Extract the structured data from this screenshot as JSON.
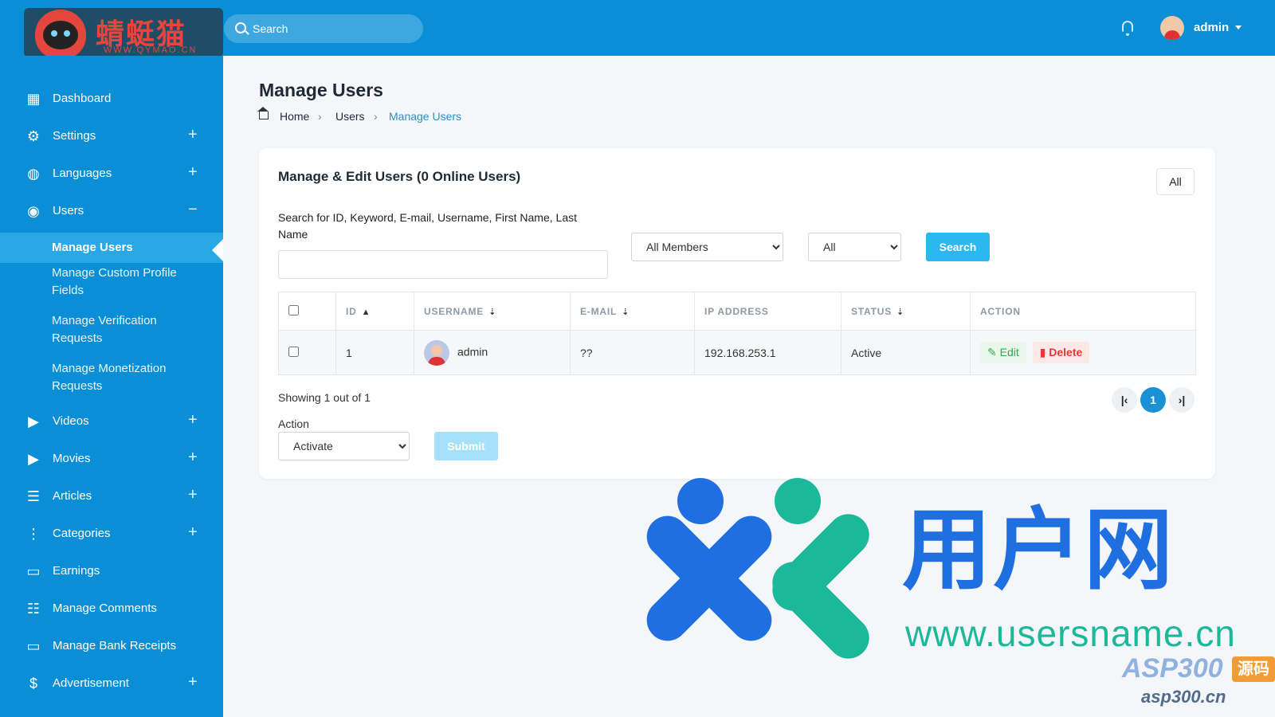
{
  "brand": {
    "logo_text": "蜻蜓猫",
    "logo_sub": "WWW.QYMAO.CN"
  },
  "topbar": {
    "search_placeholder": "Search",
    "user_name": "admin"
  },
  "sidebar": {
    "items": [
      {
        "label": "Dashboard",
        "icon": "dashboard-icon",
        "glyph": "▦",
        "expand": ""
      },
      {
        "label": "Settings",
        "icon": "gear-icon",
        "glyph": "⚙",
        "expand": "+"
      },
      {
        "label": "Languages",
        "icon": "globe-icon",
        "glyph": "◍",
        "expand": "+"
      },
      {
        "label": "Users",
        "icon": "user-circle-icon",
        "glyph": "◉",
        "expand": "−"
      },
      {
        "label": "Videos",
        "icon": "video-icon",
        "glyph": "▶",
        "expand": "+"
      },
      {
        "label": "Movies",
        "icon": "movie-icon",
        "glyph": "▶",
        "expand": "+"
      },
      {
        "label": "Articles",
        "icon": "articles-icon",
        "glyph": "☰",
        "expand": "+"
      },
      {
        "label": "Categories",
        "icon": "more-vertical-icon",
        "glyph": "⋮",
        "expand": "+"
      },
      {
        "label": "Earnings",
        "icon": "credit-card-icon",
        "glyph": "▭",
        "expand": ""
      },
      {
        "label": "Manage Comments",
        "icon": "comment-icon",
        "glyph": "☷",
        "expand": ""
      },
      {
        "label": "Manage Bank Receipts",
        "icon": "bank-card-icon",
        "glyph": "▭",
        "expand": ""
      },
      {
        "label": "Advertisement",
        "icon": "dollar-icon",
        "glyph": "$",
        "expand": "+"
      }
    ],
    "sub_items": [
      {
        "label": "Manage Users",
        "active": true
      },
      {
        "label": "Manage Custom Profile Fields",
        "active": false
      },
      {
        "label": "Manage Verification Requests",
        "active": false
      },
      {
        "label": "Manage Monetization Requests",
        "active": false
      }
    ]
  },
  "page": {
    "title": "Manage Users",
    "breadcrumb": [
      "Home",
      "Users",
      "Manage Users"
    ]
  },
  "panel": {
    "title": "Manage & Edit Users (0 Online Users)",
    "all_button": "All",
    "search_label": "Search for ID, Keyword, E-mail, Username, First Name, Last Name",
    "filter_members": "All Members",
    "filter_status": "All",
    "search_button": "Search",
    "columns": [
      "ID",
      "USERNAME",
      "E-MAIL",
      "IP ADDRESS",
      "STATUS",
      "ACTION"
    ],
    "rows": [
      {
        "id": "1",
        "username": "admin",
        "email": "??",
        "ip": "192.168.253.1",
        "status": "Active"
      }
    ],
    "edit_label": "Edit",
    "delete_label": "Delete",
    "showing": "Showing 1 out of 1",
    "page_current": "1",
    "action_label": "Action",
    "action_value": "Activate",
    "submit_label": "Submit"
  },
  "watermark": {
    "brand_cn": "用户网",
    "url": "www.usersname.cn",
    "asp": "ASP300",
    "asp_badge": "源码",
    "asp_url": "asp300.cn"
  }
}
